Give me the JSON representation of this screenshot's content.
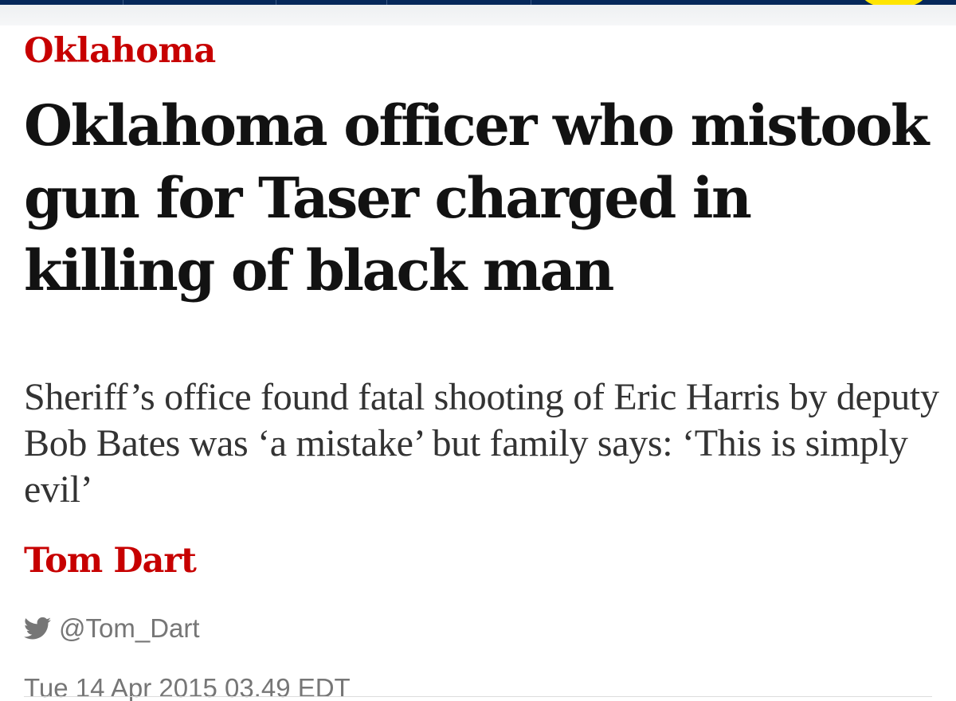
{
  "article": {
    "section": "Oklahoma",
    "headline": "Oklahoma officer who mistook gun for Taser charged in killing of black man",
    "standfirst": "Sheriff’s office found fatal shooting of Eric Harris by deputy Bob Bates was ‘a mistake’ but family says: ‘This is simply evil’",
    "author": "Tom Dart",
    "twitter_handle": "@Tom_Dart",
    "twitter_icon": "twitter-bird-icon",
    "date": "Tue 14 Apr 2015 03.49 EDT"
  },
  "colors": {
    "nav_background": "#05285a",
    "section_red": "#c70000",
    "support_yellow": "#ffe500",
    "headline_text": "#121212",
    "meta_grey": "#767676"
  }
}
